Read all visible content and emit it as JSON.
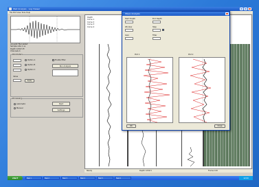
{
  "window": {
    "title": "Well Analysis - Log Viewer",
    "menu": "File  Edit  View  Tools  Help"
  },
  "left_panel": {
    "info_lines": [
      "Acoustic file loaded",
      "Sample rate 1 us",
      "Depth 1234.5 ft",
      "Channels 4"
    ],
    "group1_title": "Parameters",
    "option_a": "Option A",
    "option_b": "Option B",
    "option_c": "Option C",
    "check_label": "Enable filter",
    "field_label": "Value",
    "button_apply": "Apply",
    "button_run": "Run Analysis",
    "group2_title": "Processing",
    "radio_auto": "Automatic",
    "radio_manual": "Manual",
    "button_go": "Start",
    "button_params": "Settings"
  },
  "log_area": {
    "info_lines": [
      "Depth",
      "Curve 1",
      "Curve 2",
      "Curve 3",
      "Curve 4"
    ],
    "footer": "Depth scale"
  },
  "status": {
    "left": "Ready",
    "mid": "Depth 1234.5",
    "right": "Frame 120"
  },
  "dialog": {
    "title": "Wave Analysis",
    "labels": [
      "Start Depth",
      "End Depth",
      "Window",
      "Step",
      "Gain",
      "Filter"
    ],
    "plot1_title": "Plot 1",
    "plot2_title": "Plot 2",
    "ok": "OK",
    "close": "Close"
  },
  "taskbar": {
    "start": "start",
    "tasks": [
      "Task 1",
      "Task 2",
      "Task 3",
      "Task 4",
      "Task 5",
      "Task 6"
    ],
    "clock": "12:00"
  }
}
